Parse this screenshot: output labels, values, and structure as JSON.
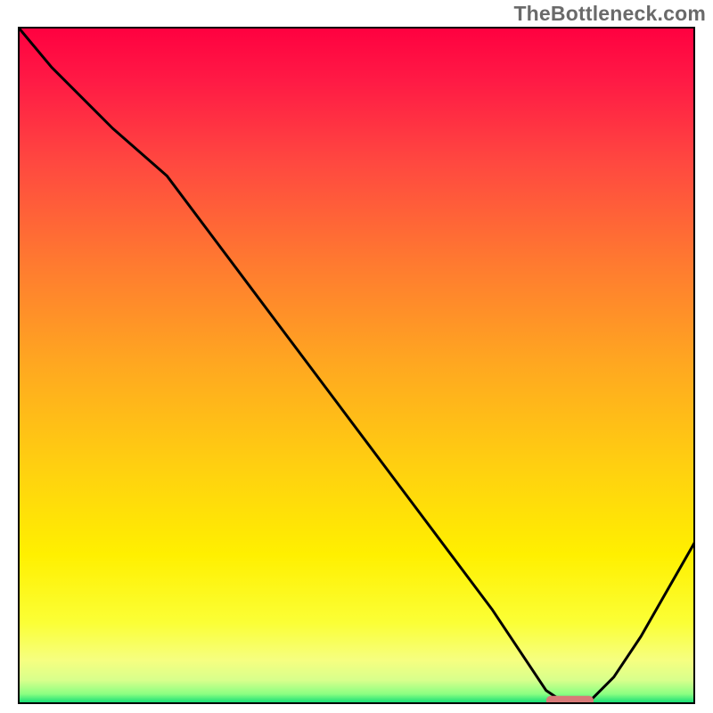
{
  "watermark": "TheBottleneck.com",
  "colors": {
    "gradient": [
      {
        "stop": 0.0,
        "hex": "#ff0040"
      },
      {
        "stop": 0.08,
        "hex": "#ff1a45"
      },
      {
        "stop": 0.2,
        "hex": "#ff4840"
      },
      {
        "stop": 0.35,
        "hex": "#ff7a30"
      },
      {
        "stop": 0.5,
        "hex": "#ffa820"
      },
      {
        "stop": 0.65,
        "hex": "#ffd010"
      },
      {
        "stop": 0.78,
        "hex": "#fff000"
      },
      {
        "stop": 0.88,
        "hex": "#fbff36"
      },
      {
        "stop": 0.935,
        "hex": "#f6ff80"
      },
      {
        "stop": 0.965,
        "hex": "#d8ff8c"
      },
      {
        "stop": 0.985,
        "hex": "#8cff82"
      },
      {
        "stop": 1.0,
        "hex": "#00d873"
      }
    ],
    "curve": "#000000",
    "marker": "#d87a78",
    "frame": "#000000"
  },
  "chart_data": {
    "type": "line",
    "title": "",
    "xlabel": "",
    "ylabel": "",
    "xlim": [
      0,
      100
    ],
    "ylim": [
      0,
      100
    ],
    "grid": false,
    "legend": false,
    "series": [
      {
        "name": "bottleneck-curve",
        "x": [
          0,
          5,
          14,
          22,
          28,
          34,
          40,
          46,
          52,
          58,
          64,
          70,
          74,
          78,
          81,
          84,
          88,
          92,
          96,
          100
        ],
        "y": [
          100,
          94,
          85,
          78,
          70,
          62,
          54,
          46,
          38,
          30,
          22,
          14,
          8,
          2,
          0,
          0,
          4,
          10,
          17,
          24
        ]
      }
    ],
    "annotations": [
      {
        "name": "ideal-component-marker",
        "type": "bar-segment",
        "x_start": 78,
        "x_end": 85,
        "y": 0.5,
        "color": "#d87a78"
      }
    ]
  }
}
